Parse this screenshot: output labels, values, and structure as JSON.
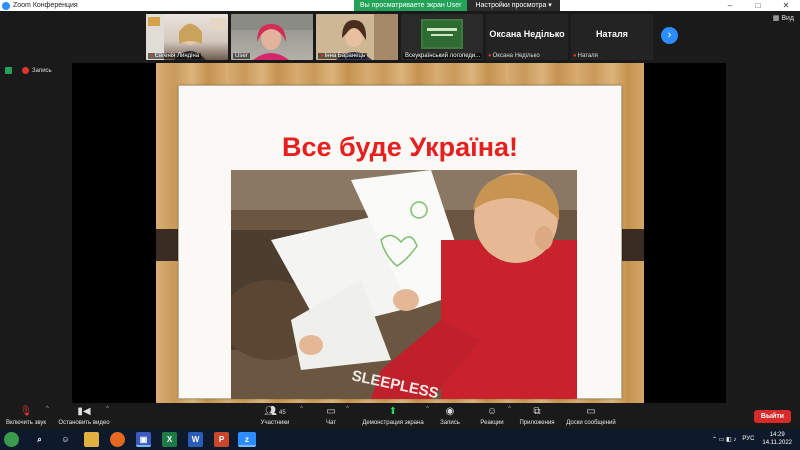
{
  "window": {
    "title": "Zoom Конференция",
    "controls": [
      "–",
      "□",
      "✕"
    ]
  },
  "share_banner": {
    "status": "Вы просматриваете экран User",
    "options": "Настройки просмотра ▾"
  },
  "participants": [
    {
      "name": "Євгенія Линдіна"
    },
    {
      "name": "User"
    },
    {
      "name": "Інна Баранець"
    },
    {
      "name": "Всеукраїнський логопеди..."
    }
  ],
  "name_tiles": [
    {
      "big": "Оксана Неділько",
      "small": "Оксана Неділько"
    },
    {
      "big": "Наталя",
      "small": "Наталя"
    }
  ],
  "view_label": "Вид",
  "recording_label": "Запись",
  "slide": {
    "title": "Все буде Україна!"
  },
  "toolbar": {
    "unmute": "Включить звук",
    "stop_video": "Остановить видео",
    "participants": "Участники",
    "participants_count": "45",
    "chat": "Чат",
    "share_screen": "Демонстрация экрана",
    "record": "Запись",
    "reactions": "Реакции",
    "apps": "Приложения",
    "whiteboards": "Доски сообщений",
    "leave": "Выйти"
  },
  "taskbar": {
    "lang": "РУС",
    "time": "14:29",
    "date": "14.11.2022"
  },
  "colors": {
    "accent": "#2d8cff",
    "green": "#23a35a",
    "leave": "#d72a2a",
    "slide_title": "#e5201e"
  }
}
